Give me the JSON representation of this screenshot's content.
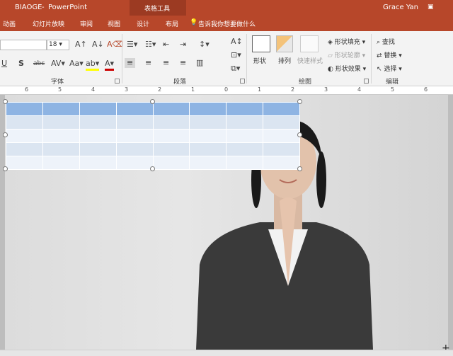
{
  "titlebar": {
    "file": "BIAOGE",
    "sep": "-",
    "app": "PowerPoint",
    "context": "表格工具",
    "user": "Grace Yan"
  },
  "tabs": [
    "动画",
    "幻灯片放映",
    "审阅",
    "视图",
    "设计",
    "布局"
  ],
  "tellme": "告诉我你想要做什么",
  "font": {
    "name": "",
    "size": "18",
    "group": "字体"
  },
  "paragraph": {
    "group": "段落"
  },
  "drawing": {
    "group": "绘图",
    "shapes": "形状",
    "arrange": "排列",
    "quick": "快速样式",
    "fill": "形状填充",
    "outline": "形状轮廓",
    "effect": "形状效果"
  },
  "editing": {
    "group": "编辑",
    "find": "查找",
    "replace": "替换",
    "select": "选择"
  },
  "ruler": [
    "6",
    "5",
    "4",
    "3",
    "2",
    "1",
    "0",
    "1",
    "2",
    "3",
    "4",
    "5",
    "6"
  ],
  "colors": {
    "accent": "#b7472a",
    "header": "#8eb4e3"
  }
}
